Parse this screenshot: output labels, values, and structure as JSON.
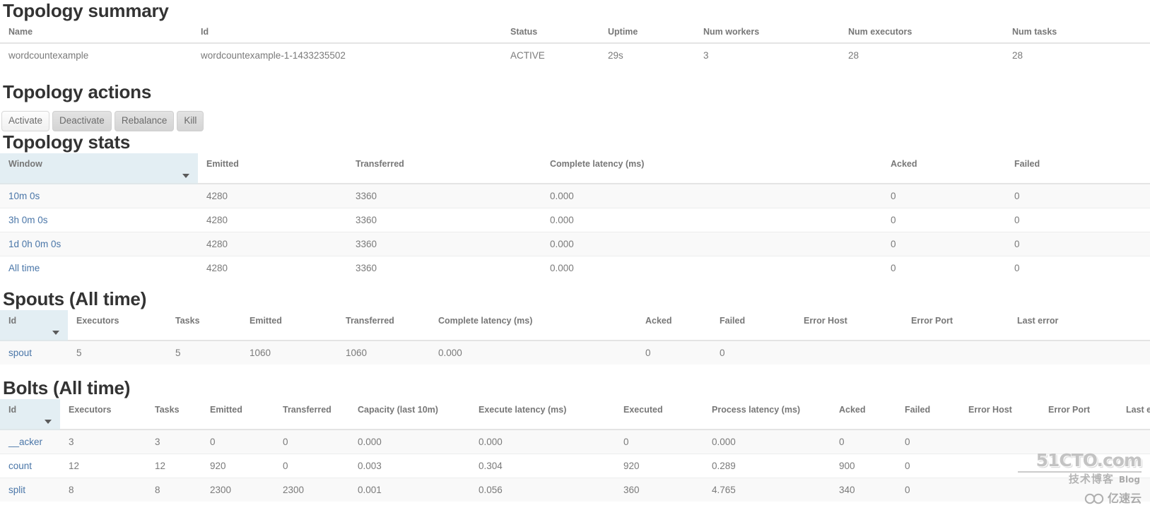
{
  "sections": {
    "summary_title": "Topology summary",
    "actions_title": "Topology actions",
    "stats_title": "Topology stats",
    "spouts_title": "Spouts (All time)",
    "bolts_title": "Bolts (All time)"
  },
  "colors": {
    "link": "#4a76a8",
    "sorted_header_bg": "#e3eef3",
    "row_odd_bg": "#f9f9f9",
    "row_even_bg": "#ffffff",
    "text": "#7a7a7a",
    "heading": "#333333"
  },
  "summary_table": {
    "columns": [
      "Name",
      "Id",
      "Status",
      "Uptime",
      "Num workers",
      "Num executors",
      "Num tasks"
    ],
    "rows": [
      {
        "name": "wordcountexample",
        "id": "wordcountexample-1-1433235502",
        "status": "ACTIVE",
        "uptime": "29s",
        "num_workers": "3",
        "num_executors": "28",
        "num_tasks": "28"
      }
    ]
  },
  "actions": {
    "buttons": [
      {
        "label": "Activate",
        "state": "disabled"
      },
      {
        "label": "Deactivate",
        "state": "enabled"
      },
      {
        "label": "Rebalance",
        "state": "enabled"
      },
      {
        "label": "Kill",
        "state": "enabled"
      }
    ]
  },
  "stats_table": {
    "columns": [
      "Window",
      "Emitted",
      "Transferred",
      "Complete latency (ms)",
      "Acked",
      "Failed"
    ],
    "sorted_column": "Window",
    "sort_direction": "desc",
    "rows": [
      {
        "window": "10m 0s",
        "emitted": "4280",
        "transferred": "3360",
        "complete_latency": "0.000",
        "acked": "0",
        "failed": "0"
      },
      {
        "window": "3h 0m 0s",
        "emitted": "4280",
        "transferred": "3360",
        "complete_latency": "0.000",
        "acked": "0",
        "failed": "0"
      },
      {
        "window": "1d 0h 0m 0s",
        "emitted": "4280",
        "transferred": "3360",
        "complete_latency": "0.000",
        "acked": "0",
        "failed": "0"
      },
      {
        "window": "All time",
        "emitted": "4280",
        "transferred": "3360",
        "complete_latency": "0.000",
        "acked": "0",
        "failed": "0"
      }
    ]
  },
  "spouts_table": {
    "columns": [
      "Id",
      "Executors",
      "Tasks",
      "Emitted",
      "Transferred",
      "Complete latency (ms)",
      "Acked",
      "Failed",
      "Error Host",
      "Error Port",
      "Last error"
    ],
    "sorted_column": "Id",
    "sort_direction": "desc",
    "rows": [
      {
        "id": "spout",
        "executors": "5",
        "tasks": "5",
        "emitted": "1060",
        "transferred": "1060",
        "complete_latency": "0.000",
        "acked": "0",
        "failed": "0",
        "error_host": "",
        "error_port": "",
        "last_error": ""
      }
    ]
  },
  "bolts_table": {
    "columns": [
      "Id",
      "Executors",
      "Tasks",
      "Emitted",
      "Transferred",
      "Capacity (last 10m)",
      "Execute latency (ms)",
      "Executed",
      "Process latency (ms)",
      "Acked",
      "Failed",
      "Error Host",
      "Error Port",
      "Last error"
    ],
    "sorted_column": "Id",
    "sort_direction": "desc",
    "rows": [
      {
        "id": "__acker",
        "executors": "3",
        "tasks": "3",
        "emitted": "0",
        "transferred": "0",
        "capacity": "0.000",
        "execute_latency": "0.000",
        "executed": "0",
        "process_latency": "0.000",
        "acked": "0",
        "failed": "0",
        "error_host": "",
        "error_port": "",
        "last_error": ""
      },
      {
        "id": "count",
        "executors": "12",
        "tasks": "12",
        "emitted": "920",
        "transferred": "0",
        "capacity": "0.003",
        "execute_latency": "0.304",
        "executed": "920",
        "process_latency": "0.289",
        "acked": "900",
        "failed": "0",
        "error_host": "",
        "error_port": "",
        "last_error": ""
      },
      {
        "id": "split",
        "executors": "8",
        "tasks": "8",
        "emitted": "2300",
        "transferred": "2300",
        "capacity": "0.001",
        "execute_latency": "0.056",
        "executed": "360",
        "process_latency": "4.765",
        "acked": "340",
        "failed": "0",
        "error_host": "",
        "error_port": "",
        "last_error": ""
      }
    ]
  },
  "watermark": {
    "brand": "51CTO.com",
    "tagline": "技术博客",
    "tagline_suffix": "Blog",
    "secondary": "亿速云"
  }
}
